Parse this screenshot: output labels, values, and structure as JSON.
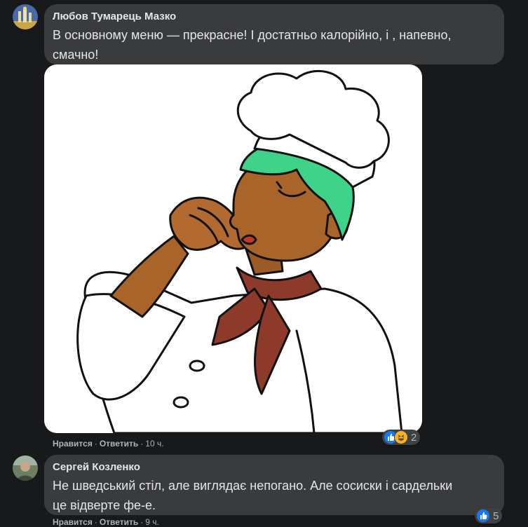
{
  "comments": [
    {
      "author": "Любов Тумарець Мазко",
      "text_line1": "В основному меню — прекрасне! І достатньо калорійно, і , напевно,",
      "text_line2": "смачно!",
      "like_label": "Нравится",
      "reply_label": "Ответить",
      "time": "10 ч.",
      "reaction_count": "2",
      "reactions": [
        "like-icon",
        "haha-icon"
      ]
    },
    {
      "author": "Сергей Козленко",
      "text_line1": "Не шведський стіл, але виглядає непогано. Але сосиски і сардельки",
      "text_line2": "це відверте фе-е.",
      "like_label": "Нравится",
      "reply_label": "Ответить",
      "time": "9 ч.",
      "reaction_count": "5",
      "reactions": [
        "like-icon"
      ]
    }
  ],
  "colors": {
    "background": "#18191a",
    "bubble": "#3a3b3c",
    "text": "#e4e6eb",
    "secondary": "#b0b3b8",
    "like_blue": "#1877f2"
  }
}
